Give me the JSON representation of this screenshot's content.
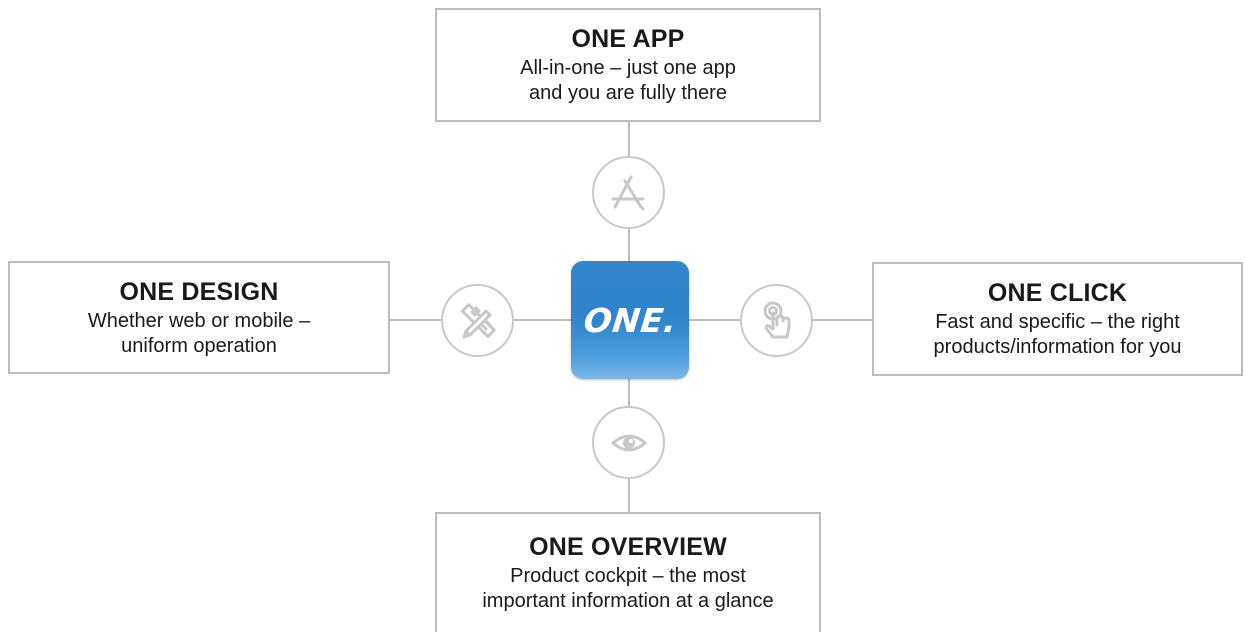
{
  "center": {
    "logo_text": "ONE."
  },
  "features": {
    "app": {
      "title": "ONE APP",
      "line1": "All-in-one – just one app",
      "line2": "and you are fully there",
      "icon": "app-store-icon"
    },
    "design": {
      "title": "ONE DESIGN",
      "line1": "Whether web or mobile –",
      "line2": "uniform operation",
      "icon": "design-tools-icon"
    },
    "click": {
      "title": "ONE CLICK",
      "line1": "Fast and specific – the right",
      "line2": "products/information for you",
      "icon": "touch-hand-icon"
    },
    "overview": {
      "title": "ONE OVERVIEW",
      "line1": "Product cockpit – the most",
      "line2": "important information at a glance",
      "icon": "eye-icon"
    }
  },
  "colors": {
    "connector": "#bdbdbd",
    "icon": "#c8c8c8",
    "logo_blue": "#1f78c4",
    "text": "#1a1a1a"
  }
}
